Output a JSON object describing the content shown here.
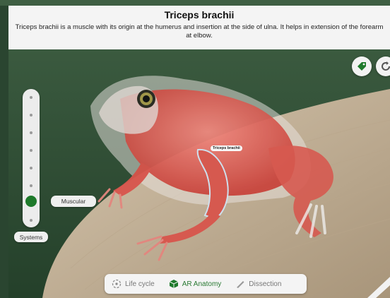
{
  "header": {
    "title": "Triceps brachii",
    "description": "Triceps brachii is a muscle with its origin at the humerus and insertion at the side of ulna. It helps in extension of the forearm at elbow."
  },
  "ar_label": "Triceps brachii",
  "layer_slider": {
    "current_layer_label": "Muscular",
    "systems_label": "Systems"
  },
  "bottom_tabs": [
    {
      "label": "Life cycle",
      "icon": "life-cycle-icon",
      "active": false
    },
    {
      "label": "AR Anatomy",
      "icon": "cube-icon",
      "active": true
    },
    {
      "label": "Dissection",
      "icon": "scalpel-icon",
      "active": false
    }
  ],
  "colors": {
    "accent": "#1e7a2b",
    "active_tab": "#2a7a33",
    "muscle": "#d8554c"
  },
  "icons": {
    "tag_button": "tag-icon",
    "reset_button": "refresh-icon"
  }
}
